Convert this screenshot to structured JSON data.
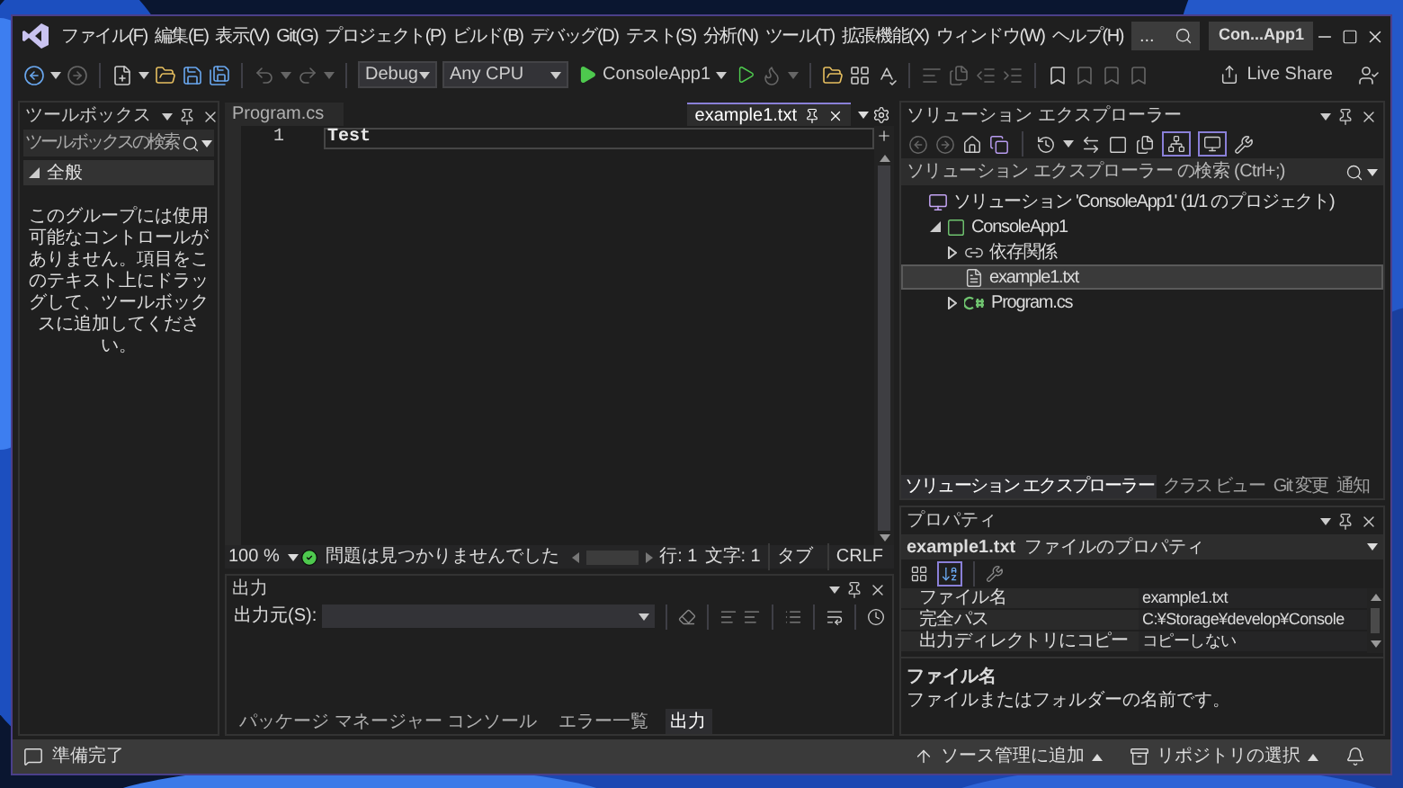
{
  "window": {
    "solution_badge": "Con...App1"
  },
  "menu": [
    "ファイル(F)",
    "編集(E)",
    "表示(V)",
    "Git(G)",
    "プロジェクト(P)",
    "ビルド(B)",
    "デバッグ(D)",
    "テスト(S)",
    "分析(N)",
    "ツール(T)",
    "拡張機能(X)",
    "ウィンドウ(W)",
    "ヘルプ(H)"
  ],
  "search_box": {
    "text": "..."
  },
  "toolbar": {
    "configuration": "Debug",
    "platform": "Any CPU",
    "start_target": "ConsoleApp1",
    "live_share": "Live Share"
  },
  "toolbox": {
    "title": "ツールボックス",
    "search_placeholder": "ツールボックスの検索",
    "group": {
      "label": "全般",
      "expanded": true
    },
    "empty_message": "このグループには使用可能なコントロールがありません。項目をこのテキスト上にドラッグして、ツールボックスに追加してください。"
  },
  "editor": {
    "tabs": [
      {
        "label": "Program.cs",
        "selected": false
      },
      {
        "label": "example1.txt",
        "selected": true
      }
    ],
    "lines": [
      {
        "number": "1",
        "text": "Test"
      }
    ],
    "status": {
      "zoom": "100 %",
      "issues": "問題は見つかりませんでした",
      "line": "行: 1",
      "column": "文字: 1",
      "indent": "タブ",
      "line_ending": "CRLF"
    }
  },
  "output": {
    "title": "出力",
    "source_label": "出力元(S):"
  },
  "bottom_tabs": [
    {
      "label": "パッケージ マネージャー コンソール",
      "selected": false
    },
    {
      "label": "エラー一覧",
      "selected": false
    },
    {
      "label": "出力",
      "selected": true
    }
  ],
  "solution_explorer": {
    "title": "ソリューション エクスプローラー",
    "toolbar_toggles": [
      {
        "kind": "sync",
        "selected": true
      },
      {
        "kind": "preview",
        "selected": true
      }
    ],
    "search_placeholder": "ソリューション エクスプローラー の検索 (Ctrl+;)",
    "tree": [
      {
        "label": "ソリューション 'ConsoleApp1' (1/1 のプロジェクト)",
        "kind": "solution",
        "selected": false,
        "children": [
          {
            "label": "ConsoleApp1",
            "kind": "project",
            "selected": false,
            "expanded": true,
            "children": [
              {
                "label": "依存関係",
                "kind": "dependencies",
                "selected": false,
                "expanded": false
              },
              {
                "label": "example1.txt",
                "kind": "file",
                "selected": true
              },
              {
                "label": "Program.cs",
                "kind": "csharp",
                "selected": false,
                "expanded": false
              }
            ]
          }
        ]
      }
    ]
  },
  "right_tabs": [
    {
      "label": "ソリューション エクスプローラー",
      "selected": true
    },
    {
      "label": "クラス ビュー",
      "selected": false
    },
    {
      "label": "Git 変更",
      "selected": false
    },
    {
      "label": "通知",
      "selected": false
    }
  ],
  "properties": {
    "title": "プロパティ",
    "object_name": "example1.txt",
    "object_type": "ファイルのプロパティ",
    "view_buttons": [
      {
        "kind": "categorized",
        "selected": false
      },
      {
        "kind": "alphabetical",
        "selected": true
      }
    ],
    "rows": [
      {
        "name": "ファイル名",
        "value": "example1.txt"
      },
      {
        "name": "完全パス",
        "value": "C:¥Storage¥develop¥Console"
      },
      {
        "name": "出力ディレクトリにコピー",
        "value": "コピーしない"
      }
    ],
    "description": {
      "title": "ファイル名",
      "text": "ファイルまたはフォルダーの名前です。"
    }
  },
  "status_bar": {
    "message": "準備完了",
    "source_control": "ソース管理に追加",
    "repository": "リポジトリの選択"
  }
}
